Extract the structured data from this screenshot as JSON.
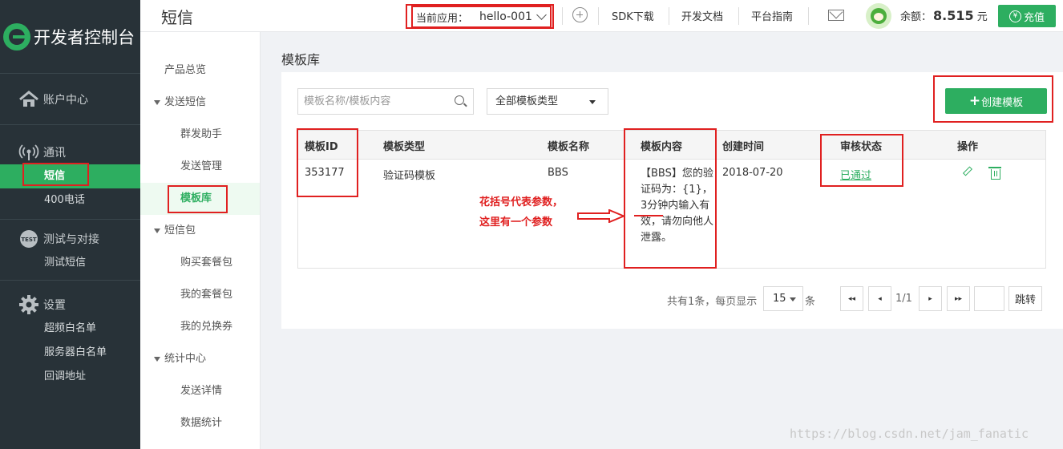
{
  "brand": {
    "logo_text": "开发者控制台"
  },
  "sidebar": {
    "groups": [
      {
        "label": "账户中心",
        "icon": "home-icon",
        "items": []
      },
      {
        "label": "通讯",
        "icon": "signal-icon",
        "items": [
          {
            "label": "短信",
            "active": true
          },
          {
            "label": "400电话",
            "active": false
          }
        ]
      },
      {
        "label": "测试与对接",
        "icon": "test-icon",
        "items": [
          {
            "label": "测试短信",
            "active": false
          }
        ]
      },
      {
        "label": "设置",
        "icon": "gear-icon",
        "items": [
          {
            "label": "超频白名单"
          },
          {
            "label": "服务器白名单"
          },
          {
            "label": "回调地址"
          }
        ]
      }
    ]
  },
  "header": {
    "title": "短信",
    "app_label": "当前应用：",
    "app_value": "hello-001",
    "links": [
      "SDK下载",
      "开发文档",
      "平台指南"
    ],
    "balance_label": "余额：",
    "balance_amount": "8.515",
    "balance_unit": "元",
    "recharge_label": "充值",
    "recharge_symbol": "¥"
  },
  "subnav": {
    "items": [
      {
        "label": "产品总览",
        "level": 1
      },
      {
        "label": "发送短信",
        "level": 1,
        "expanded": true
      },
      {
        "label": "群发助手",
        "level": 2
      },
      {
        "label": "发送管理",
        "level": 2
      },
      {
        "label": "模板库",
        "level": 2,
        "active": true
      },
      {
        "label": "短信包",
        "level": 1,
        "expanded": true
      },
      {
        "label": "购买套餐包",
        "level": 2
      },
      {
        "label": "我的套餐包",
        "level": 2
      },
      {
        "label": "我的兑换券",
        "level": 2
      },
      {
        "label": "统计中心",
        "level": 1,
        "expanded": true
      },
      {
        "label": "发送详情",
        "level": 2
      },
      {
        "label": "数据统计",
        "level": 2
      }
    ]
  },
  "main": {
    "section_title": "模板库",
    "search_placeholder": "模板名称/模板内容",
    "type_filter": "全部模板类型",
    "create_label": "创建模板",
    "create_symbol": "+",
    "columns": [
      "模板ID",
      "模板类型",
      "模板名称",
      "模板内容",
      "创建时间",
      "审核状态",
      "操作"
    ],
    "rows": [
      {
        "id": "353177",
        "type": "验证码模板",
        "name": "BBS",
        "content": "【BBS】您的验证码为：{1}，3分钟内输入有效，请勿向他人泄露。",
        "created": "2018-07-20",
        "status": "已通过"
      }
    ],
    "annotation_line1": "花括号代表参数，",
    "annotation_line2": "这里有一个参数"
  },
  "pager": {
    "summary": "共有1条，每页显示",
    "page_size": "15",
    "unit": "条",
    "page_info": "1/1",
    "go_label": "跳转",
    "first": "◂◂",
    "prev": "◂",
    "next": "▸",
    "last": "▸▸"
  },
  "watermark": "https://blog.csdn.net/jam_fanatic",
  "colors": {
    "accent": "#2dae60",
    "sidebar_bg": "#283238",
    "highlight": "#e02020"
  }
}
